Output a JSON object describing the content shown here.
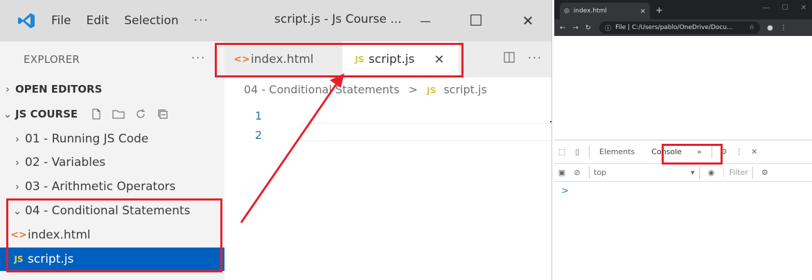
{
  "vscode": {
    "menu": [
      "File",
      "Edit",
      "Selection"
    ],
    "menu_more": "···",
    "window_title": "script.js - Js Course ...",
    "window_buttons": {
      "minimize": "—",
      "maximize": "☐",
      "close": "✕"
    },
    "sidebar": {
      "heading": "EXPLORER",
      "heading_more": "···",
      "open_editors": "OPEN EDITORS",
      "project": "JS COURSE",
      "folders": [
        {
          "label": "01 - Running JS Code"
        },
        {
          "label": "02 - Variables"
        },
        {
          "label": "03 - Arithmetic Operators"
        },
        {
          "label": "04 - Conditional Statements"
        }
      ],
      "files": [
        {
          "label": "index.html",
          "icon": "<>"
        },
        {
          "label": "script.js",
          "icon": "JS"
        }
      ]
    },
    "tabs": [
      {
        "label": "index.html",
        "icon": "<>"
      },
      {
        "label": "script.js",
        "icon": "JS",
        "close": "✕"
      }
    ],
    "tab_more": "···",
    "breadcrumb": {
      "folder": "04 - Conditional Statements",
      "sep": ">",
      "icon": "JS",
      "file": "script.js"
    },
    "line_numbers": [
      "1",
      "2"
    ]
  },
  "chrome": {
    "tab_title": "index.html",
    "tab_close": "×",
    "new_tab": "+",
    "address": "File | C:/Users/pablo/OneDrive/Docu...",
    "devtools": {
      "tabs": [
        "Elements",
        "Console"
      ],
      "more": "»",
      "context": "top",
      "filter": "Filter",
      "prompt": ">"
    }
  },
  "colors": {
    "highlight": "#e4202b",
    "selection": "#0060c0",
    "js_yellow": "#cbcb41",
    "html_orange": "#e37933"
  }
}
